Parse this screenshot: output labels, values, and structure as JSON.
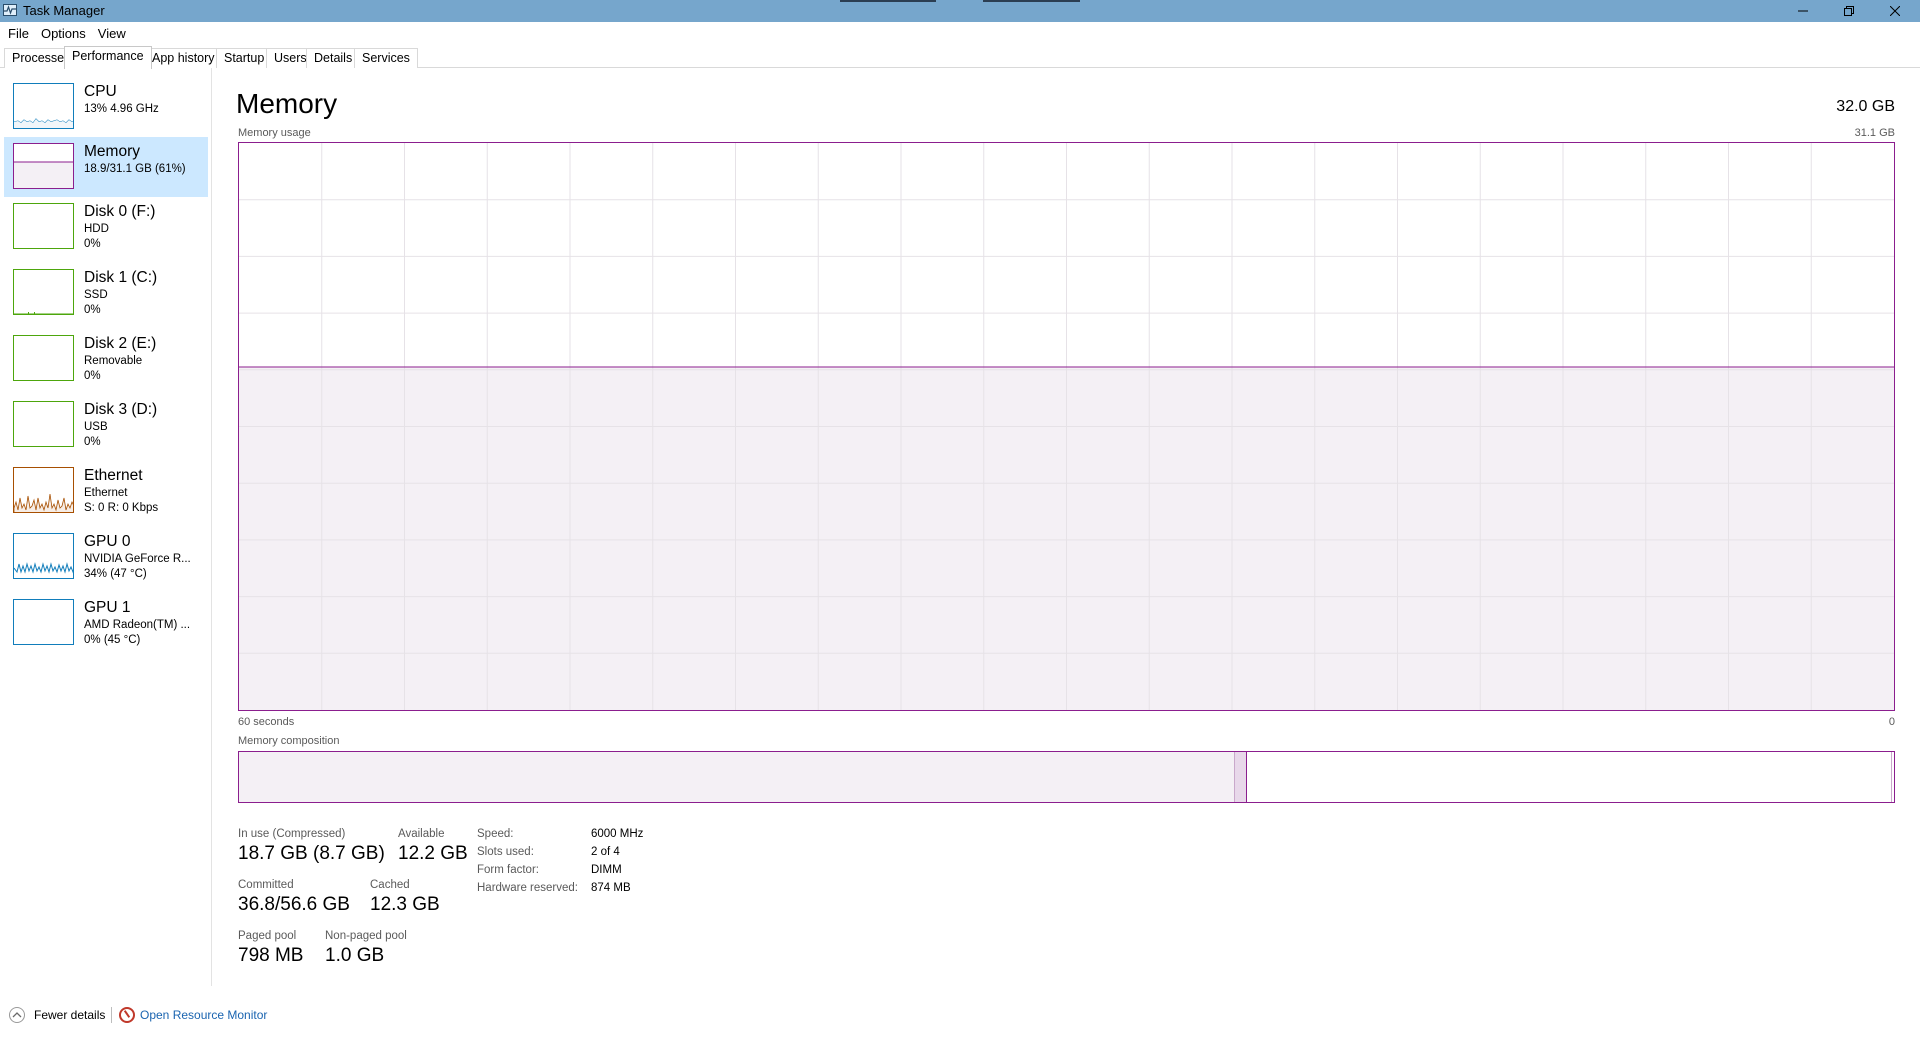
{
  "window": {
    "title": "Task Manager",
    "icon": "task-manager-icon"
  },
  "menu": [
    "File",
    "Options",
    "View"
  ],
  "tabs": [
    {
      "label": "Processes"
    },
    {
      "label": "Performance",
      "active": true
    },
    {
      "label": "App history"
    },
    {
      "label": "Startup"
    },
    {
      "label": "Users"
    },
    {
      "label": "Details"
    },
    {
      "label": "Services"
    }
  ],
  "sidebar": [
    {
      "title": "CPU",
      "lines": [
        "13% 4.96 GHz"
      ],
      "color": "#117dbb",
      "graph": "cpu"
    },
    {
      "title": "Memory",
      "lines": [
        "18.9/31.1 GB (61%)"
      ],
      "color": "#8b1e8e",
      "graph": "memory",
      "selected": true
    },
    {
      "title": "Disk 0 (F:)",
      "lines": [
        "HDD",
        "0%"
      ],
      "color": "#4da60c",
      "graph": "flat"
    },
    {
      "title": "Disk 1 (C:)",
      "lines": [
        "SSD",
        "0%"
      ],
      "color": "#4da60c",
      "graph": "flat"
    },
    {
      "title": "Disk 2 (E:)",
      "lines": [
        "Removable",
        "0%"
      ],
      "color": "#4da60c",
      "graph": "none"
    },
    {
      "title": "Disk 3 (D:)",
      "lines": [
        "USB",
        "0%"
      ],
      "color": "#4da60c",
      "graph": "none"
    },
    {
      "title": "Ethernet",
      "lines": [
        "Ethernet",
        "S: 0 R: 0 Kbps"
      ],
      "color": "#a74f01",
      "graph": "ethernet"
    },
    {
      "title": "GPU 0",
      "lines": [
        "NVIDIA GeForce R...",
        "34% (47 °C)"
      ],
      "color": "#117dbb",
      "graph": "gpu"
    },
    {
      "title": "GPU 1",
      "lines": [
        "AMD Radeon(TM) ...",
        "0% (45 °C)"
      ],
      "color": "#117dbb",
      "graph": "none"
    }
  ],
  "main": {
    "title": "Memory",
    "total": "32.0 GB",
    "usage_label": "Memory usage",
    "usage_max": "31.1 GB",
    "time_left": "60 seconds",
    "time_right": "0",
    "composition_label": "Memory composition",
    "usage_fraction": 0.605,
    "composition": {
      "in_use_fraction": 0.602,
      "modified_fraction": 0.007
    }
  },
  "stats": {
    "in_use": {
      "label": "In use (Compressed)",
      "value": "18.7 GB (8.7 GB)"
    },
    "available": {
      "label": "Available",
      "value": "12.2 GB"
    },
    "committed": {
      "label": "Committed",
      "value": "36.8/56.6 GB"
    },
    "cached": {
      "label": "Cached",
      "value": "12.3 GB"
    },
    "paged_pool": {
      "label": "Paged pool",
      "value": "798 MB"
    },
    "non_paged_pool": {
      "label": "Non-paged pool",
      "value": "1.0 GB"
    }
  },
  "specs": [
    {
      "label": "Speed:",
      "value": "6000 MHz"
    },
    {
      "label": "Slots used:",
      "value": "2 of 4"
    },
    {
      "label": "Form factor:",
      "value": "DIMM"
    },
    {
      "label": "Hardware reserved:",
      "value": "874 MB"
    }
  ],
  "footer": {
    "fewer": "Fewer details",
    "resource_monitor": "Open Resource Monitor"
  },
  "colors": {
    "titlebar": "#76a6cc",
    "memory": "#8b1e8e",
    "selected": "#cce8ff",
    "link": "#1a64b0"
  }
}
